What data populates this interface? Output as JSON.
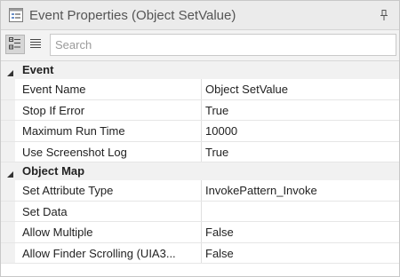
{
  "window": {
    "title": "Event Properties (Object SetValue)"
  },
  "icons": {
    "title": "properties-window-icon",
    "pin": "pin-icon",
    "categorized": "categorized-view-icon",
    "alphabetical": "alphabetical-list-icon",
    "collapse": "collapse-arrow-icon"
  },
  "search": {
    "placeholder": "Search",
    "value": ""
  },
  "categories": [
    {
      "label": "Event",
      "rows": [
        {
          "name": "Event Name",
          "value": "Object SetValue"
        },
        {
          "name": "Stop If Error",
          "value": "True"
        },
        {
          "name": "Maximum Run Time",
          "value": "10000"
        },
        {
          "name": "Use Screenshot Log",
          "value": "True"
        }
      ]
    },
    {
      "label": "Object Map",
      "rows": [
        {
          "name": "Set Attribute Type",
          "value": "InvokePattern_Invoke"
        },
        {
          "name": "Set Data",
          "value": ""
        },
        {
          "name": "Allow Multiple",
          "value": "False"
        },
        {
          "name": "Allow Finder Scrolling (UIA3...",
          "value": "False"
        }
      ]
    }
  ],
  "colors": {
    "titlebar": "#ebebeb",
    "toolbar": "#f3f3f3",
    "category_bg": "#f1f1f1",
    "grid_line": "#e6e6e6"
  }
}
